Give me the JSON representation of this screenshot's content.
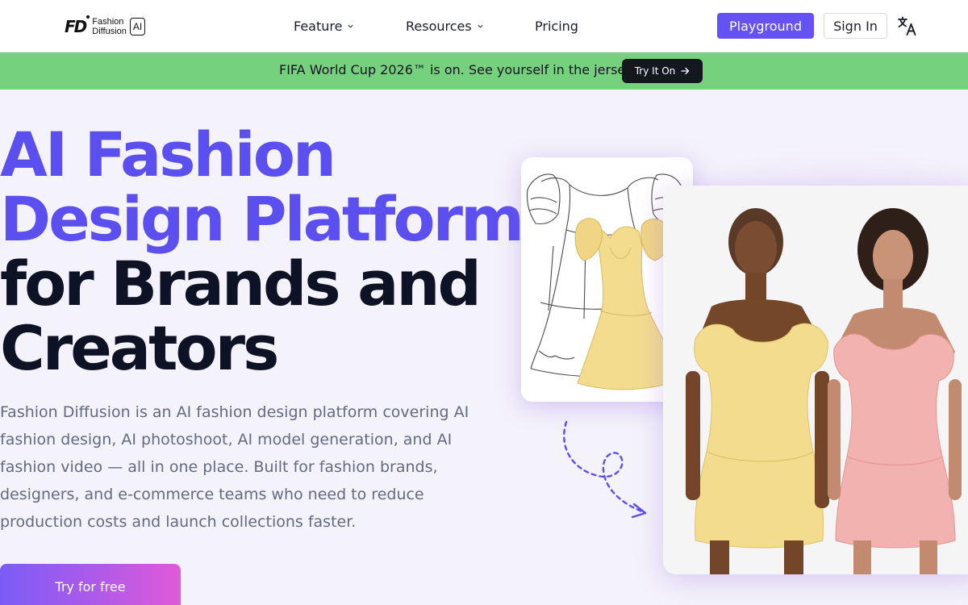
{
  "header": {
    "logo": {
      "mark": "FD",
      "name_line1": "Fashion",
      "name_line2": "Diffusion",
      "badge": "AI"
    },
    "nav": [
      {
        "label": "Feature",
        "has_dropdown": true
      },
      {
        "label": "Resources",
        "has_dropdown": true
      },
      {
        "label": "Pricing",
        "has_dropdown": false
      }
    ],
    "playground_label": "Playground",
    "signin_label": "Sign In",
    "language_icon": "translate-icon"
  },
  "banner": {
    "text": "FIFA World Cup 2026™ is on. See yourself in the jersey",
    "button_label": "Try It On",
    "button_icon": "arrow-right-icon",
    "color": "#76d17f"
  },
  "hero": {
    "title_line1": "AI Fashion",
    "title_line2": "Design Platform",
    "title_line3": "for Brands and",
    "title_line4": "Creators",
    "description": "Fashion Diffusion is an AI fashion design platform covering AI fashion design, AI photoshoot, AI model generation, and AI fashion video — all in one place. Built for fashion brands, designers, and e-commerce teams who need to reduce production costs and launch collections faster.",
    "cta_label": "Try for free",
    "accent_color": "#5b4ff0"
  },
  "colors": {
    "primary": "#6552f5",
    "dress_yellow": "#f3dc8e",
    "dress_pink": "#f2b3b0"
  }
}
